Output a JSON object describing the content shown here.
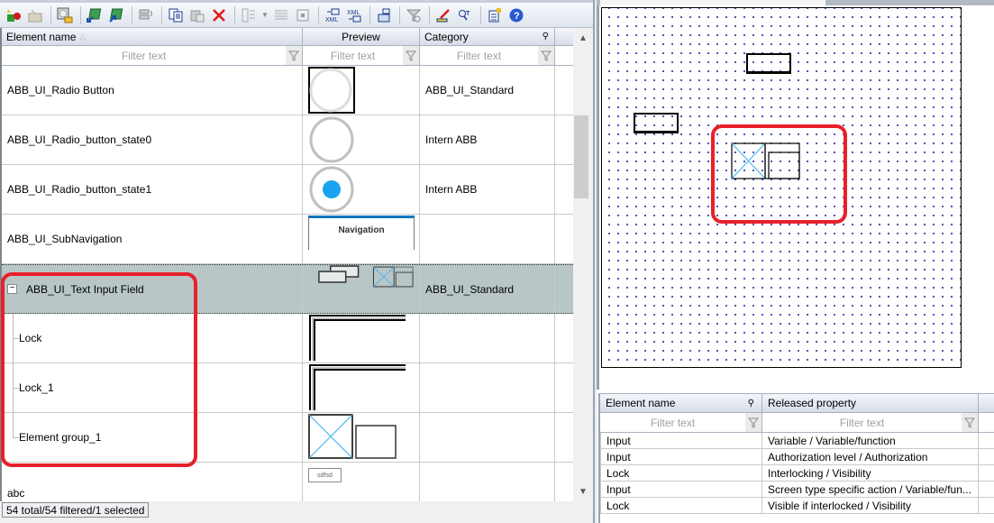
{
  "toolbar": {
    "buttons": [
      {
        "icon": "new-element-icon"
      },
      {
        "icon": "open-folder-icon"
      },
      {
        "icon": "load-library-icon"
      },
      {
        "icon": "import-element-icon"
      },
      {
        "icon": "export-element-icon"
      },
      {
        "icon": "replace-icon"
      },
      {
        "icon": "copy-icon"
      },
      {
        "icon": "paste-icon"
      },
      {
        "icon": "delete-icon"
      },
      {
        "icon": "view-layout-icon"
      },
      {
        "icon": "list-view-icon"
      },
      {
        "icon": "expand-icon"
      },
      {
        "icon": "import-xml-icon"
      },
      {
        "icon": "export-xml-icon"
      },
      {
        "icon": "import-image-icon"
      },
      {
        "icon": "clear-filter-icon"
      },
      {
        "icon": "edit-icon"
      },
      {
        "icon": "search-text-icon"
      },
      {
        "icon": "properties-icon"
      },
      {
        "icon": "help-icon"
      }
    ]
  },
  "library_grid": {
    "columns": {
      "name": "Element name",
      "preview": "Preview",
      "category": "Category"
    },
    "filter_placeholder": "Filter text",
    "rows": [
      {
        "name": "ABB_UI_Radio Button",
        "category": "ABB_UI_Standard",
        "preview": "radio-button-framed"
      },
      {
        "name": "ABB_UI_Radio_button_state0",
        "category": "Intern ABB",
        "preview": "radio-button-empty"
      },
      {
        "name": "ABB_UI_Radio_button_state1",
        "category": "Intern ABB",
        "preview": "radio-button-checked"
      },
      {
        "name": "ABB_UI_SubNavigation",
        "category": "",
        "preview": "navigation-tab",
        "preview_text": "Navigation"
      },
      {
        "name": "ABB_UI_Text Input Field",
        "category": "ABB_UI_Standard",
        "preview": "text-input-group",
        "expanded": true,
        "selected": true
      },
      {
        "name": "Lock",
        "category": "",
        "preview": "lock-frame",
        "child": true
      },
      {
        "name": "Lock_1",
        "category": "",
        "preview": "lock-frame",
        "child": true
      },
      {
        "name": "Element group_1",
        "category": "",
        "preview": "element-group",
        "child": true
      },
      {
        "name": "abc",
        "category": "",
        "preview": "small-button",
        "preview_text": "sdfsd"
      }
    ],
    "status": "54 total/54 filtered/1 selected"
  },
  "properties_grid": {
    "columns": {
      "element": "Element name",
      "property": "Released property"
    },
    "filter_placeholder": "Filter text",
    "rows": [
      {
        "element": "Input",
        "property": "Variable / Variable/function"
      },
      {
        "element": "Input",
        "property": "Authorization level / Authorization"
      },
      {
        "element": "Lock",
        "property": "Interlocking / Visibility"
      },
      {
        "element": "Input",
        "property": "Screen type specific action / Variable/fun..."
      },
      {
        "element": "Lock",
        "property": "Visible if interlocked / Visibility"
      }
    ]
  },
  "colors": {
    "highlight": "#e8202a",
    "selected_row": "#b8c6c8",
    "radio_fill": "#1aa3f0",
    "grid_dot": "#1a1aa0"
  }
}
